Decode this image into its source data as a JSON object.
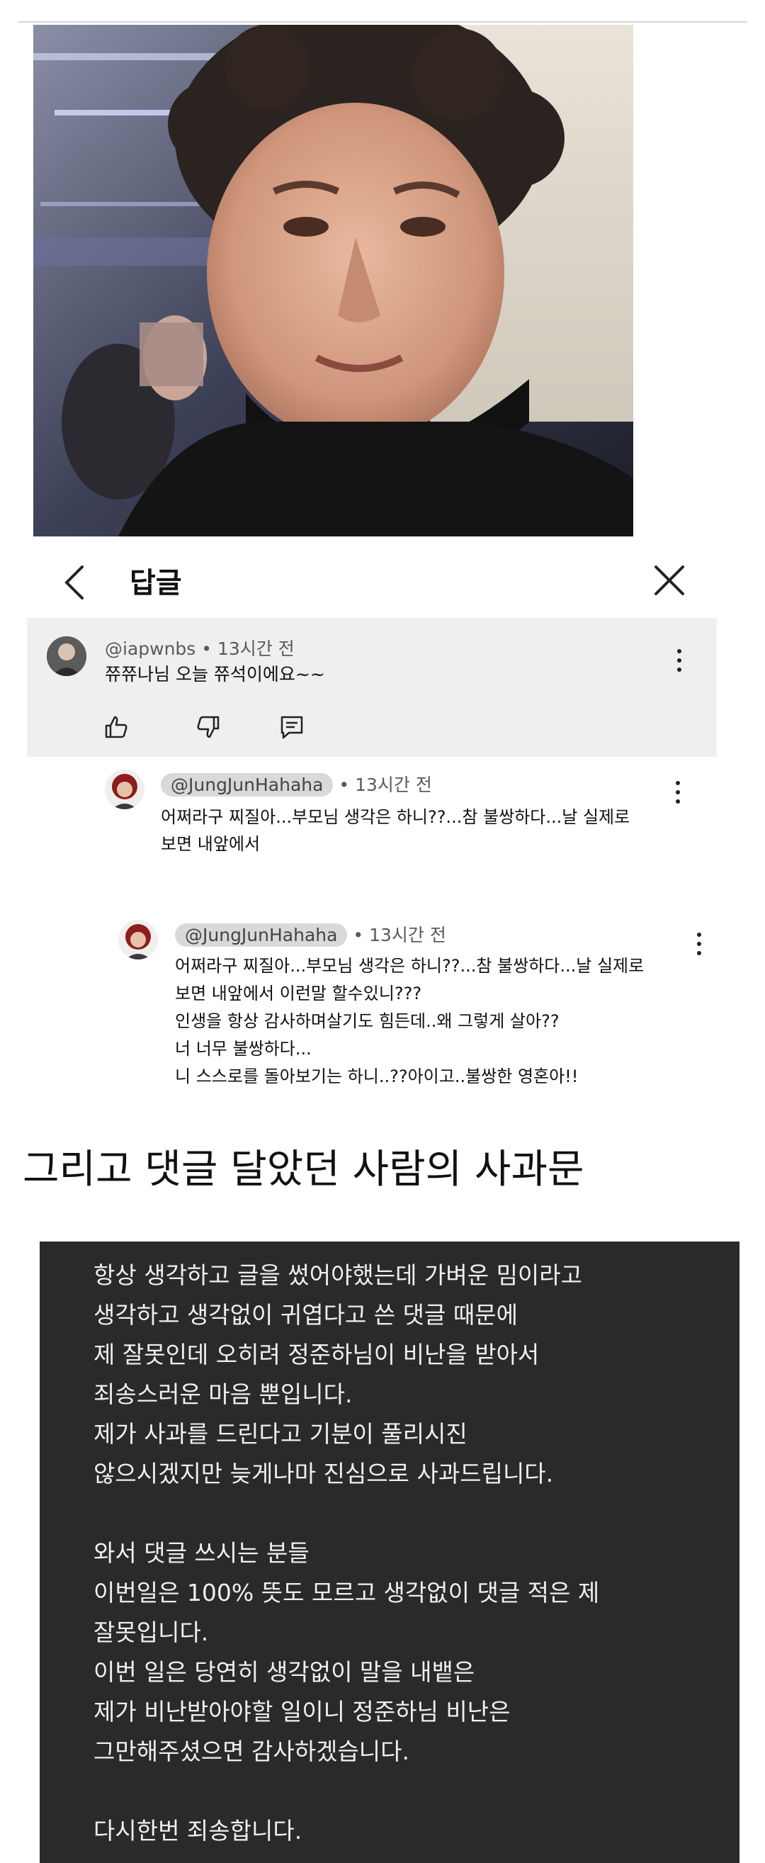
{
  "reply_header": {
    "title": "답글"
  },
  "parent_comment": {
    "handle": "@iapwnbs",
    "time": "13시간 전",
    "text": "쮸쮸나님 오늘 쮸석이에요~~"
  },
  "reply_1": {
    "handle": "@JungJunHahaha",
    "time": "13시간 전",
    "lines": [
      "어쩌라구 찌질아...부모님 생각은 하니??...참 불쌍하다...날 실제로",
      "보면 내앞에서"
    ]
  },
  "reply_2": {
    "handle": "@JungJunHahaha",
    "time": "13시간 전",
    "lines": [
      "어쩌라구 찌질아...부모님 생각은 하니??...참 불쌍하다...날 실제로",
      "보면 내앞에서 이런말 할수있니???",
      "인생을 항상 감사하며살기도 힘든데..왜 그렇게 살아??",
      "너 너무 불쌍하다...",
      "니 스스로를 돌아보기는 하니..??아이고..불쌍한 영혼아!!"
    ]
  },
  "heading": "그리고 댓글 달았던 사람의 사과문",
  "apology": {
    "lines": [
      "항상 생각하고 글을 썼어야했는데 가벼운 밈이라고",
      "생각하고 생각없이 귀엽다고 쓴 댓글 때문에",
      "제 잘못인데 오히려 정준하님이 비난을 받아서",
      "죄송스러운 마음 뿐입니다.",
      "제가 사과를 드린다고 기분이 풀리시진",
      "않으시겠지만 늦게나마 진심으로 사과드립니다.",
      "",
      "와서 댓글 쓰시는 분들",
      "이번일은 100% 뜻도 모르고 생각없이 댓글 적은 제",
      "잘못입니다.",
      "이번 일은  당연히 생각없이 말을 내뱉은",
      "제가 비난받아야할 일이니 정준하님 비난은",
      "그만해주셨으면 감사하겠습니다.",
      "",
      "다시한번 죄송합니다."
    ]
  },
  "icons": {
    "back": "chevron-left-icon",
    "close": "close-icon",
    "more": "more-vert-icon",
    "like": "thumbs-up-icon",
    "dislike": "thumbs-down-icon",
    "reply": "comment-icon"
  }
}
